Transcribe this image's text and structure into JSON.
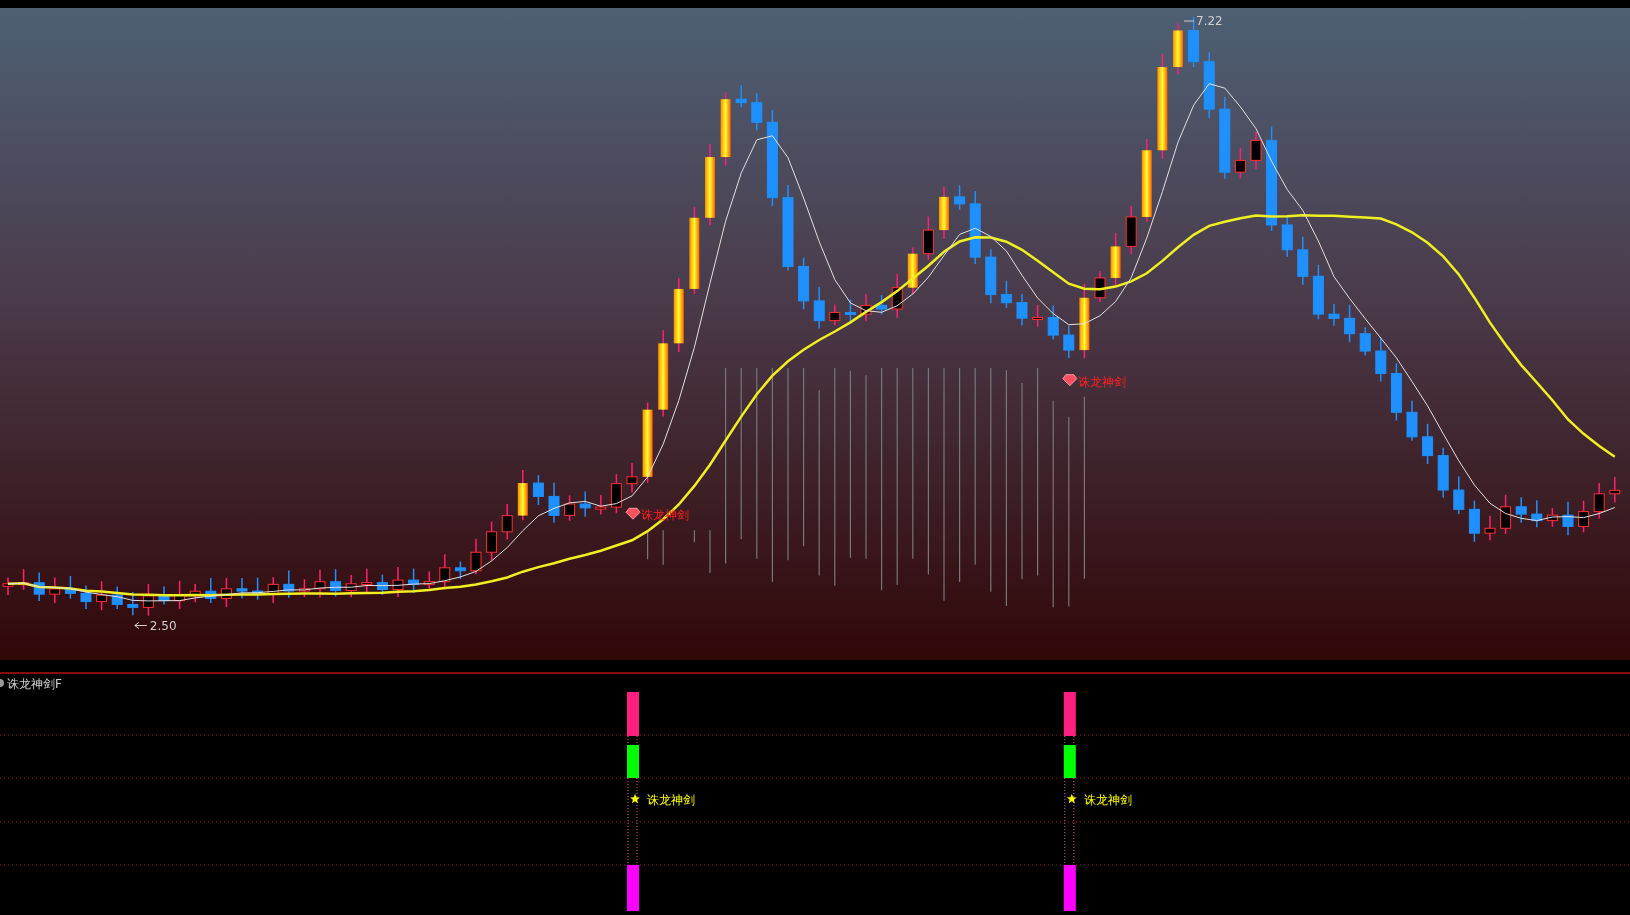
{
  "main_chart": {
    "high_label": "7.22",
    "low_label": "2.50",
    "signals": [
      {
        "text": "诛龙神剑"
      },
      {
        "text": "诛龙神剑"
      }
    ]
  },
  "indicator_panel": {
    "title": "诛龙神剑F",
    "signals": [
      {
        "text": "诛龙神剑"
      },
      {
        "text": "诛龙神剑"
      }
    ]
  }
}
